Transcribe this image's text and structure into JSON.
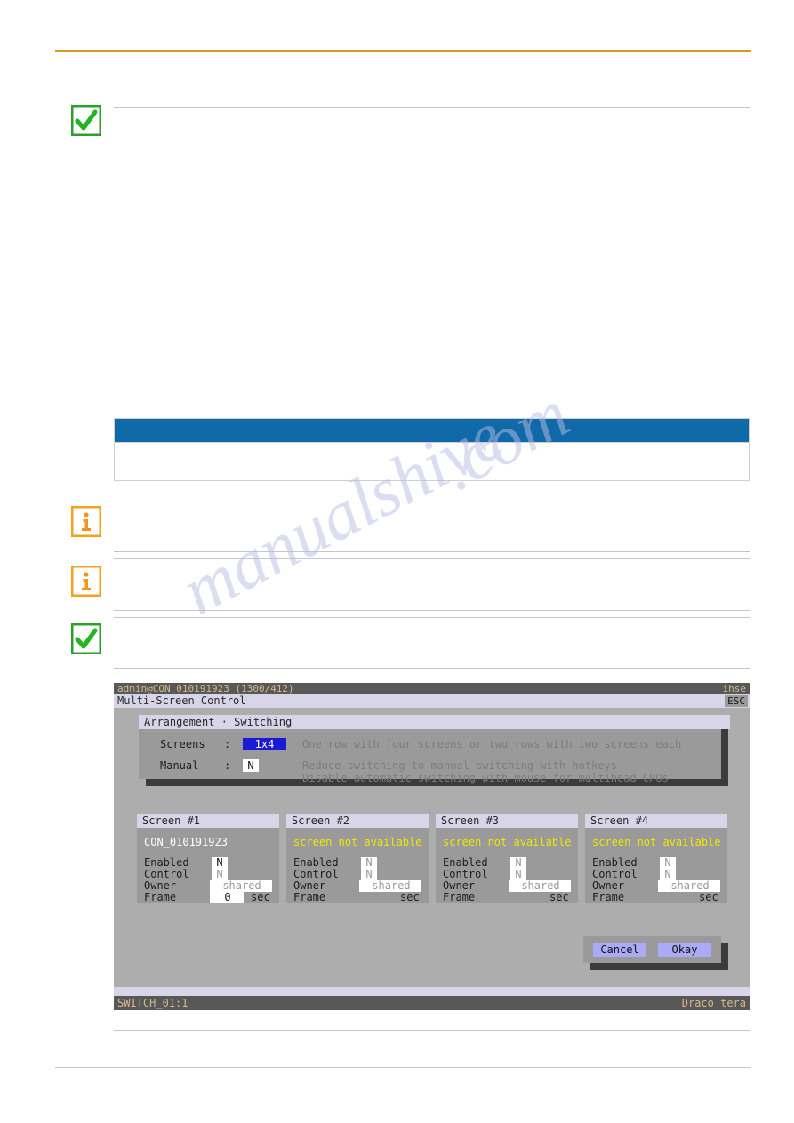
{
  "document": {
    "accent_rule_color": "#d89a22",
    "table_header_color": "#1069a8",
    "watermark_text_1": "manualshive",
    "watermark_text_2": ".com",
    "notes": [
      {
        "icon": "green-check-icon",
        "text": ""
      },
      {
        "icon": "orange-info-icon",
        "text": ""
      },
      {
        "icon": "orange-info-icon",
        "text": ""
      },
      {
        "icon": "green-check-icon",
        "text": ""
      }
    ]
  },
  "osd": {
    "titlebar": {
      "session": "admin@CON_010191923 (1300/412)",
      "brand": "ihse"
    },
    "subbar": {
      "title": "Multi-Screen Control",
      "esc_label": "ESC"
    },
    "arrangement": {
      "tab_label": "Arrangement · Switching",
      "fields": [
        {
          "label": "Screens",
          "colon": ":",
          "value": "1x4",
          "selected": true,
          "hints": [
            "One row with four screens or two rows with two screens each"
          ]
        },
        {
          "label": "Manual",
          "colon": ":",
          "value": "N",
          "selected": false,
          "hints": [
            "Reduce switching to manual switching with hotkeys",
            "Disable automatic switching with mouse for multihead CPUs"
          ]
        }
      ]
    },
    "screens": [
      {
        "title": "Screen #1",
        "name": "CON_010191923",
        "available": true,
        "rows": [
          {
            "label": "Enabled",
            "value": "N",
            "unit": "",
            "dim": false
          },
          {
            "label": "Control",
            "value": "N",
            "unit": "",
            "dim": true
          },
          {
            "label": "Owner",
            "value": "shared",
            "unit": "",
            "dim": true
          },
          {
            "label": "Frame",
            "value": "0",
            "unit": "sec",
            "dim": false
          }
        ]
      },
      {
        "title": "Screen #2",
        "name": "screen not available",
        "available": false,
        "rows": [
          {
            "label": "Enabled",
            "value": "N",
            "unit": "",
            "dim": true
          },
          {
            "label": "Control",
            "value": "N",
            "unit": "",
            "dim": true
          },
          {
            "label": "Owner",
            "value": "shared",
            "unit": "",
            "dim": true
          },
          {
            "label": "Frame",
            "value": "",
            "unit": "sec",
            "dim": true
          }
        ]
      },
      {
        "title": "Screen #3",
        "name": "screen not available",
        "available": false,
        "rows": [
          {
            "label": "Enabled",
            "value": "N",
            "unit": "",
            "dim": true
          },
          {
            "label": "Control",
            "value": "N",
            "unit": "",
            "dim": true
          },
          {
            "label": "Owner",
            "value": "shared",
            "unit": "",
            "dim": true
          },
          {
            "label": "Frame",
            "value": "",
            "unit": "sec",
            "dim": true
          }
        ]
      },
      {
        "title": "Screen #4",
        "name": "screen not available",
        "available": false,
        "rows": [
          {
            "label": "Enabled",
            "value": "N",
            "unit": "",
            "dim": true
          },
          {
            "label": "Control",
            "value": "N",
            "unit": "",
            "dim": true
          },
          {
            "label": "Owner",
            "value": "shared",
            "unit": "",
            "dim": true
          },
          {
            "label": "Frame",
            "value": "",
            "unit": "sec",
            "dim": true
          }
        ]
      }
    ],
    "buttons": {
      "cancel_label": "Cancel",
      "okay_label": "Okay"
    },
    "statusbar": {
      "left": "SWITCH_01:1",
      "right": "Draco tera"
    }
  }
}
